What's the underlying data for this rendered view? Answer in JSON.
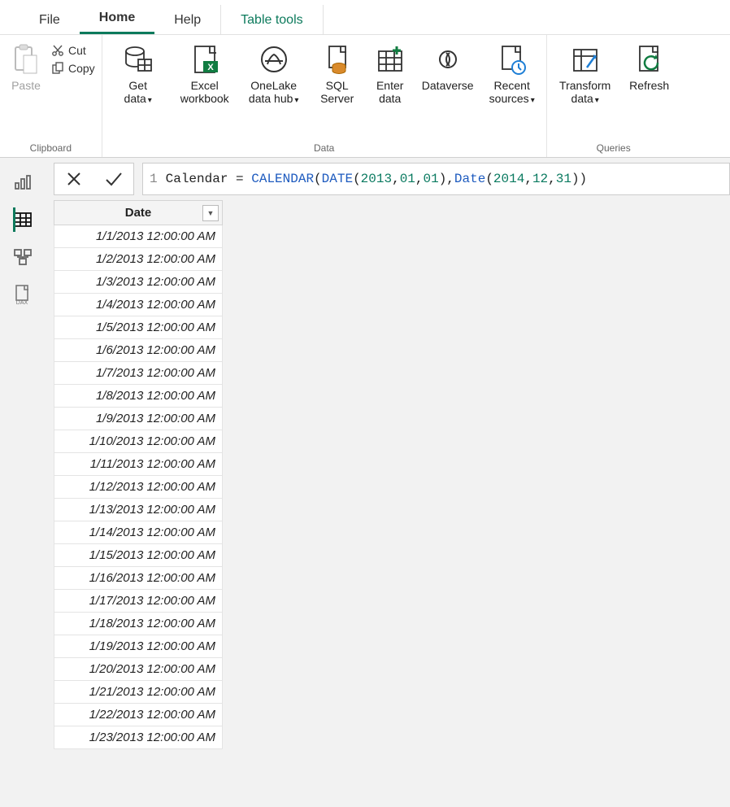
{
  "tabs": {
    "file": "File",
    "home": "Home",
    "help": "Help",
    "tabletools": "Table tools"
  },
  "ribbon": {
    "clipboard": {
      "paste": "Paste",
      "cut": "Cut",
      "copy": "Copy",
      "group": "Clipboard"
    },
    "data": {
      "getdata": {
        "l1": "Get",
        "l2": "data"
      },
      "excel": {
        "l1": "Excel",
        "l2": "workbook"
      },
      "onelake": {
        "l1": "OneLake",
        "l2": "data hub"
      },
      "sql": {
        "l1": "SQL",
        "l2": "Server"
      },
      "enter": {
        "l1": "Enter",
        "l2": "data"
      },
      "dataverse": {
        "l1": "Dataverse",
        "l2": ""
      },
      "recent": {
        "l1": "Recent",
        "l2": "sources"
      },
      "group": "Data"
    },
    "queries": {
      "transform": {
        "l1": "Transform",
        "l2": "data"
      },
      "refresh": {
        "l1": "Refresh",
        "l2": ""
      },
      "group": "Queries"
    }
  },
  "formula": {
    "line_no": "1",
    "text_plain": "Calendar = CALENDAR(DATE(2013,01,01),Date(2014,12,31))",
    "tokens": [
      {
        "t": "Calendar = ",
        "c": "pn"
      },
      {
        "t": "CALENDAR",
        "c": "kw"
      },
      {
        "t": "(",
        "c": "pn"
      },
      {
        "t": "DATE",
        "c": "kw"
      },
      {
        "t": "(",
        "c": "pn"
      },
      {
        "t": "2013",
        "c": "num"
      },
      {
        "t": ",",
        "c": "pn"
      },
      {
        "t": "01",
        "c": "num"
      },
      {
        "t": ",",
        "c": "pn"
      },
      {
        "t": "01",
        "c": "num"
      },
      {
        "t": "),",
        "c": "pn"
      },
      {
        "t": "Date",
        "c": "kw"
      },
      {
        "t": "(",
        "c": "pn"
      },
      {
        "t": "2014",
        "c": "num"
      },
      {
        "t": ",",
        "c": "pn"
      },
      {
        "t": "12",
        "c": "num"
      },
      {
        "t": ",",
        "c": "pn"
      },
      {
        "t": "31",
        "c": "num"
      },
      {
        "t": "))",
        "c": "pn"
      }
    ]
  },
  "table": {
    "header": "Date",
    "rows": [
      "1/1/2013 12:00:00 AM",
      "1/2/2013 12:00:00 AM",
      "1/3/2013 12:00:00 AM",
      "1/4/2013 12:00:00 AM",
      "1/5/2013 12:00:00 AM",
      "1/6/2013 12:00:00 AM",
      "1/7/2013 12:00:00 AM",
      "1/8/2013 12:00:00 AM",
      "1/9/2013 12:00:00 AM",
      "1/10/2013 12:00:00 AM",
      "1/11/2013 12:00:00 AM",
      "1/12/2013 12:00:00 AM",
      "1/13/2013 12:00:00 AM",
      "1/14/2013 12:00:00 AM",
      "1/15/2013 12:00:00 AM",
      "1/16/2013 12:00:00 AM",
      "1/17/2013 12:00:00 AM",
      "1/18/2013 12:00:00 AM",
      "1/19/2013 12:00:00 AM",
      "1/20/2013 12:00:00 AM",
      "1/21/2013 12:00:00 AM",
      "1/22/2013 12:00:00 AM",
      "1/23/2013 12:00:00 AM"
    ]
  }
}
